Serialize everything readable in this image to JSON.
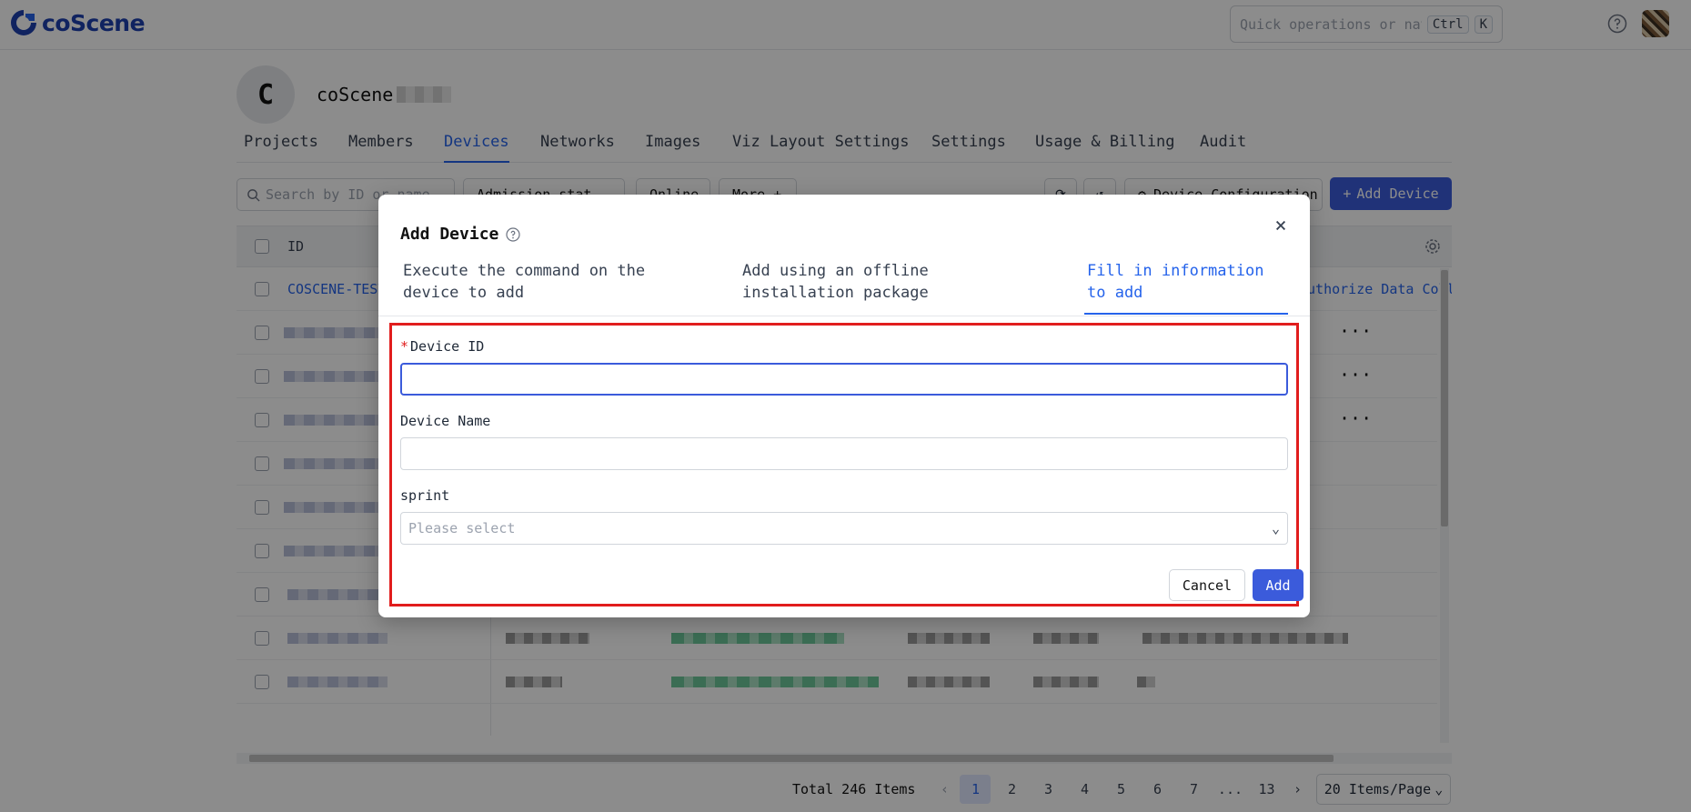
{
  "app": {
    "brand": "coScene",
    "accent_color": "#3b5bdb",
    "quick_search_placeholder": "Quick operations or navigate to ...",
    "shortcut_keys": [
      "Ctrl",
      "K"
    ]
  },
  "org": {
    "avatar_letter": "C",
    "name": "coScene"
  },
  "tabs": [
    {
      "label": "Projects"
    },
    {
      "label": "Members"
    },
    {
      "label": "Devices",
      "active": true
    },
    {
      "label": "Networks"
    },
    {
      "label": "Images"
    },
    {
      "label": "Viz Layout Settings"
    },
    {
      "label": "Settings"
    },
    {
      "label": "Usage & Billing"
    },
    {
      "label": "Audit"
    }
  ],
  "toolbar": {
    "search_placeholder": "Search by ID or name",
    "admission_filter": "Admission stat",
    "online_filter": "Online",
    "more_filter": "More +",
    "device_config_label": "Device Configuration",
    "add_device_label": "Add Device"
  },
  "table": {
    "header_id": "ID",
    "first_row_id": "COSCENE-TEST-",
    "first_row_action": "Authorize Data Coll."
  },
  "pagination": {
    "total": "Total 246 Items",
    "pages": [
      "1",
      "2",
      "3",
      "4",
      "5",
      "6",
      "7",
      "...",
      "13"
    ],
    "current": "1",
    "page_size": "20 Items/Page"
  },
  "modal": {
    "title": "Add Device",
    "tabs": [
      {
        "label": "Execute the command on the device to add"
      },
      {
        "label": "Add using an offline installation package"
      },
      {
        "label": "Fill in information to add",
        "active": true
      }
    ],
    "fields": {
      "device_id_label": "Device ID",
      "device_id_required_mark": "*",
      "device_id_value": "",
      "device_name_label": "Device Name",
      "device_name_value": "",
      "sprint_label": "sprint",
      "sprint_placeholder": "Please select"
    },
    "cancel_label": "Cancel",
    "add_label": "Add"
  }
}
